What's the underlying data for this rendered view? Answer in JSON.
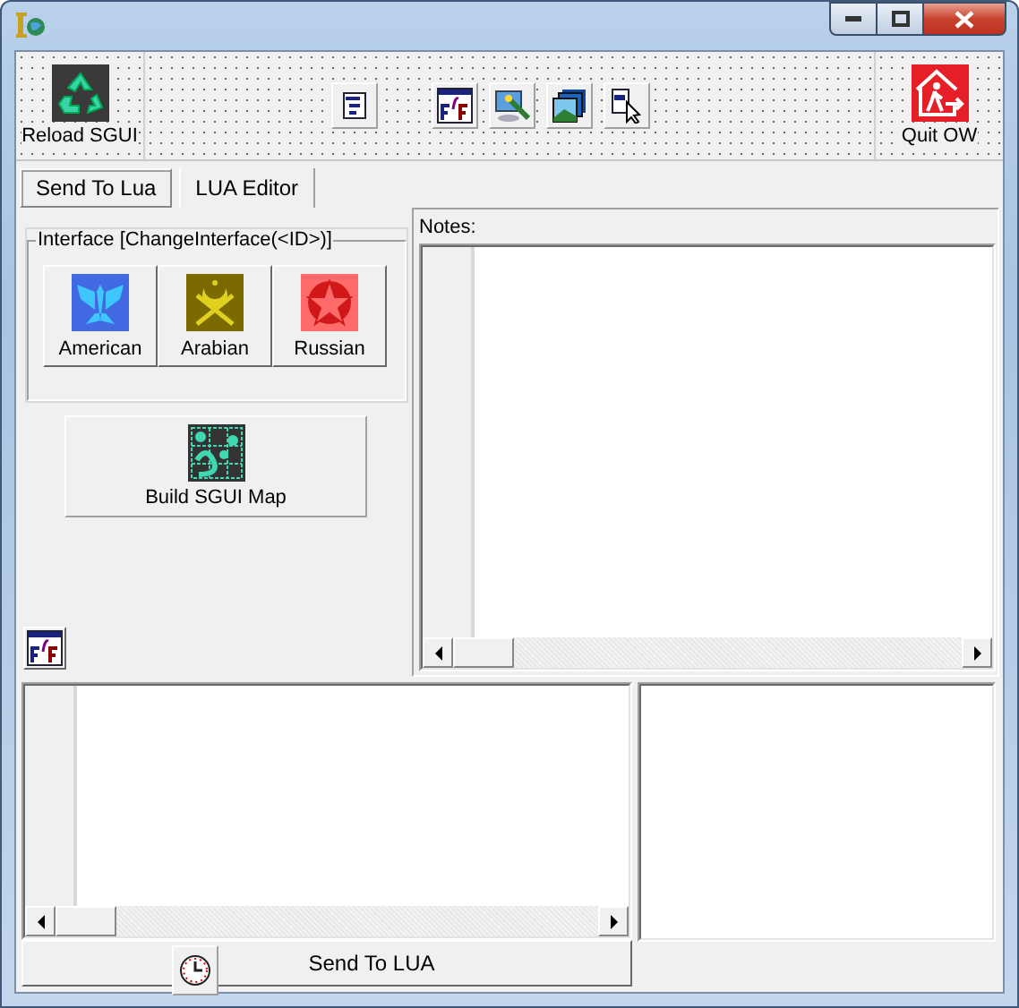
{
  "toolbar": {
    "reload": {
      "label": "Reload SGUI"
    },
    "tools": [
      {
        "kind": "listing"
      },
      {
        "kind": "font"
      },
      {
        "kind": "monitor"
      },
      {
        "kind": "layers"
      },
      {
        "kind": "pointer"
      }
    ],
    "quit": {
      "label": "Quit OW"
    }
  },
  "tabs": [
    {
      "label": "Send To Lua",
      "selected": true
    },
    {
      "label": "LUA Editor",
      "selected": false
    }
  ],
  "interface_group": {
    "title": "Interface [ChangeInterface(<ID>)]",
    "buttons": [
      {
        "label": "American",
        "kind": "american"
      },
      {
        "label": "Arabian",
        "kind": "arabian"
      },
      {
        "label": "Russian",
        "kind": "russian"
      }
    ]
  },
  "build_button": {
    "label": "Build SGUI Map"
  },
  "notes": {
    "label": "Notes:"
  },
  "send_button": {
    "label": "Send To LUA"
  }
}
